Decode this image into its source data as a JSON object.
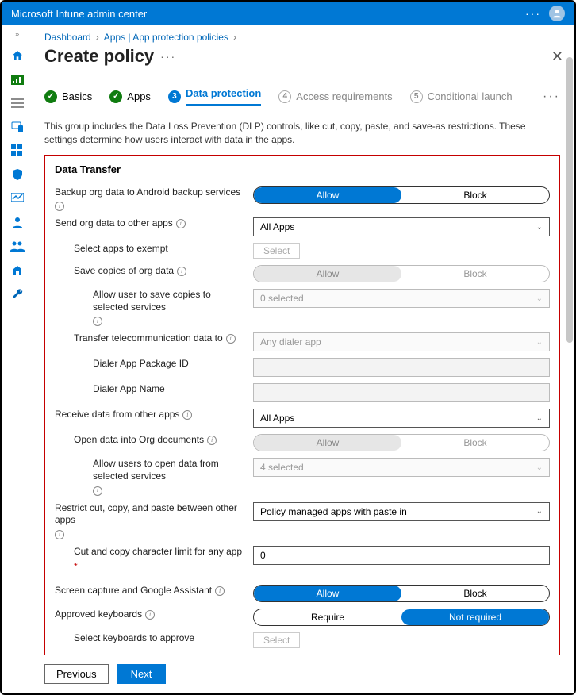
{
  "topbar": {
    "title": "Microsoft Intune admin center"
  },
  "breadcrumb": {
    "items": [
      "Dashboard",
      "Apps | App protection policies"
    ]
  },
  "page": {
    "title": "Create policy"
  },
  "wizard": {
    "steps": [
      {
        "num": "✓",
        "label": "Basics"
      },
      {
        "num": "✓",
        "label": "Apps"
      },
      {
        "num": "3",
        "label": "Data protection"
      },
      {
        "num": "4",
        "label": "Access requirements"
      },
      {
        "num": "5",
        "label": "Conditional launch"
      }
    ]
  },
  "description": "This group includes the Data Loss Prevention (DLP) controls, like cut, copy, paste, and save-as restrictions. These settings determine how users interact with data in the apps.",
  "section": {
    "title": "Data Transfer"
  },
  "fields": {
    "backup": {
      "label": "Backup org data to Android backup services",
      "opt_allow": "Allow",
      "opt_block": "Block"
    },
    "send": {
      "label": "Send org data to other apps",
      "value": "All Apps"
    },
    "exempt": {
      "label": "Select apps to exempt",
      "btn": "Select"
    },
    "savecopies": {
      "label": "Save copies of org data",
      "opt_allow": "Allow",
      "opt_block": "Block"
    },
    "saveservices": {
      "label": "Allow user to save copies to selected services",
      "value": "0 selected"
    },
    "telecom": {
      "label": "Transfer telecommunication data to",
      "value": "Any dialer app"
    },
    "dialerpkg": {
      "label": "Dialer App Package ID"
    },
    "dialername": {
      "label": "Dialer App Name"
    },
    "receive": {
      "label": "Receive data from other apps",
      "value": "All Apps"
    },
    "openorg": {
      "label": "Open data into Org documents",
      "opt_allow": "Allow",
      "opt_block": "Block"
    },
    "openservices": {
      "label": "Allow users to open data from selected services",
      "value": "4 selected"
    },
    "restrict": {
      "label": "Restrict cut, copy, and paste between other apps",
      "value": "Policy managed apps with paste in"
    },
    "charlimit": {
      "label": "Cut and copy character limit for any app",
      "value": "0"
    },
    "screencap": {
      "label": "Screen capture and Google Assistant",
      "opt_allow": "Allow",
      "opt_block": "Block"
    },
    "keyboards": {
      "label": "Approved keyboards",
      "opt_require": "Require",
      "opt_notreq": "Not required"
    },
    "selectkbd": {
      "label": "Select keyboards to approve",
      "btn": "Select"
    }
  },
  "footer": {
    "prev": "Previous",
    "next": "Next"
  }
}
